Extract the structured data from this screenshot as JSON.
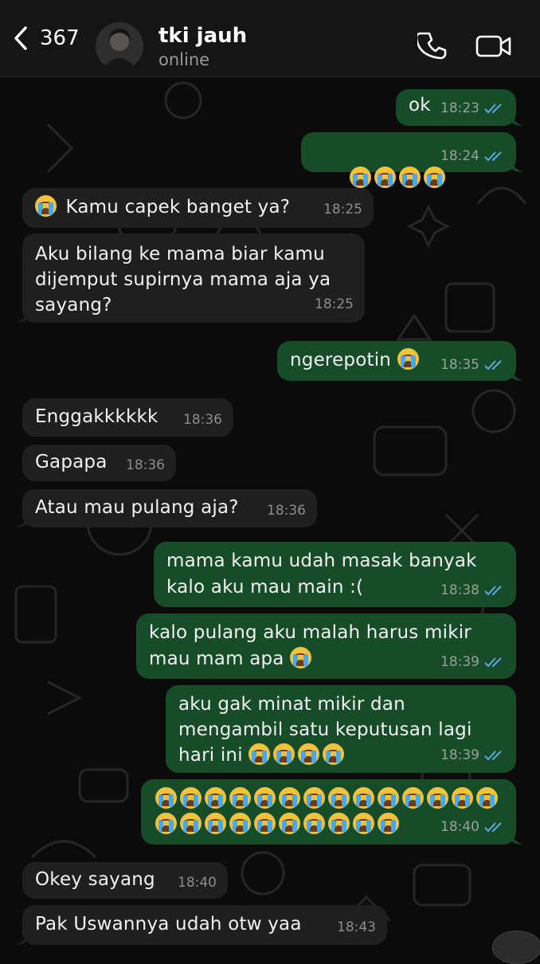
{
  "header": {
    "back_count": "367",
    "contact_name": "tki jauh",
    "status": "online"
  },
  "colors": {
    "outgoing_bubble": "#164c28",
    "incoming_bubble": "#1f1f1f",
    "read_tick": "#5aa9e6",
    "background": "#0b0b0b"
  },
  "messages": [
    {
      "dir": "out",
      "text": "ok",
      "time": "18:23",
      "read": true
    },
    {
      "dir": "out",
      "text": "😭😭😭😭",
      "time": "18:24",
      "read": true
    },
    {
      "dir": "in",
      "text": "😭 Kamu capek banget ya?",
      "time": "18:25"
    },
    {
      "dir": "in",
      "text": "Aku bilang ke mama biar kamu dijemput supirnya mama aja ya sayang?",
      "time": "18:25"
    },
    {
      "dir": "out",
      "text": "ngerepotin 😭",
      "time": "18:35",
      "read": true
    },
    {
      "dir": "in",
      "text": "Enggakkkkkk",
      "time": "18:36"
    },
    {
      "dir": "in",
      "text": "Gapapa",
      "time": "18:36"
    },
    {
      "dir": "in",
      "text": "Atau mau pulang aja?",
      "time": "18:36"
    },
    {
      "dir": "out",
      "text": "mama kamu udah masak banyak kalo aku mau main :(",
      "time": "18:38",
      "read": true
    },
    {
      "dir": "out",
      "text": "kalo pulang aku malah harus mikir mau mam apa 😭",
      "time": "18:39",
      "read": true
    },
    {
      "dir": "out",
      "text": "aku gak minat mikir dan mengambil satu keputusan lagi hari ini 😭😭😭😭",
      "time": "18:39",
      "read": true
    },
    {
      "dir": "out",
      "text": "😭😭😭😭😭😭😭😭😭😭😭😭😭😭😭😭😭😭😭😭😭😭😭😭",
      "time": "18:40",
      "read": true
    },
    {
      "dir": "in",
      "text": "Okey sayang",
      "time": "18:40"
    },
    {
      "dir": "in",
      "text": "Pak Uswannya udah otw yaa",
      "time": "18:43"
    }
  ]
}
